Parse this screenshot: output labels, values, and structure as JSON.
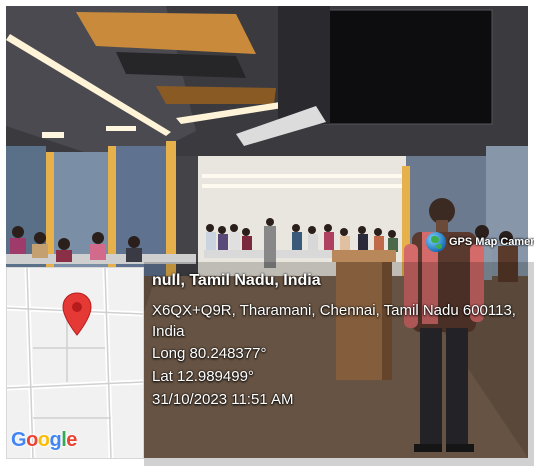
{
  "photo": {
    "description_tag": "classroom-photo",
    "badge": {
      "label": "GPS Map Camera",
      "icon": "globe-icon"
    }
  },
  "geotag": {
    "title": "null, Tamil Nadu, India",
    "address_line1": "X6QX+Q9R, Tharamani, Chennai, Tamil Nadu 600113,",
    "address_line2": "India",
    "longitude": "Long 80.248377°",
    "latitude": "Lat 12.989499°",
    "datetime": "31/10/2023 11:51 AM",
    "map_logo": "Google",
    "marker_icon": "map-pin-icon",
    "marker_color": "#e53935"
  }
}
